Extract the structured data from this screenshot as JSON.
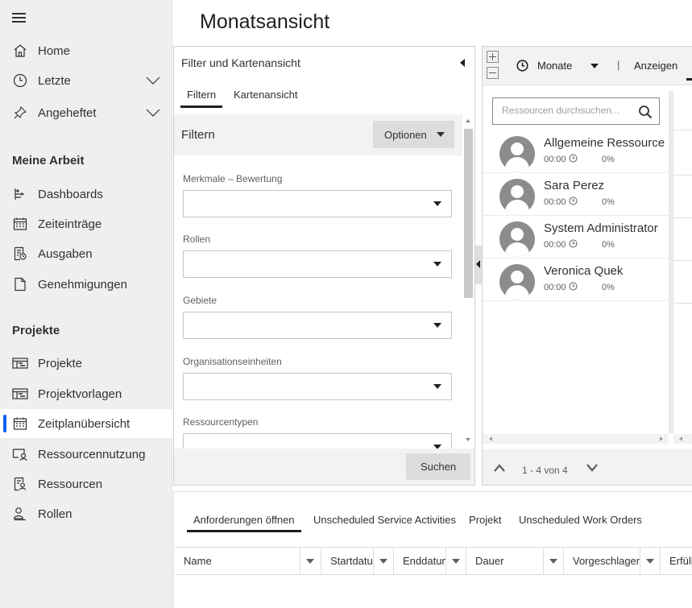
{
  "page_title": "Monatsansicht",
  "sidebar": {
    "items_top": [
      {
        "label": "Home",
        "icon": "home-icon"
      },
      {
        "label": "Letzte",
        "icon": "clock-icon",
        "expandable": true
      },
      {
        "label": "Angeheftet",
        "icon": "pin-icon",
        "expandable": true
      }
    ],
    "section_my_work": "Meine Arbeit",
    "items_my_work": [
      {
        "label": "Dashboards",
        "icon": "dashboard-icon"
      },
      {
        "label": "Zeiteinträge",
        "icon": "calendar-icon"
      },
      {
        "label": "Ausgaben",
        "icon": "receipt-icon"
      },
      {
        "label": "Genehmigungen",
        "icon": "document-icon"
      }
    ],
    "section_projects": "Projekte",
    "items_projects": [
      {
        "label": "Projekte",
        "icon": "project-icon"
      },
      {
        "label": "Projektvorlagen",
        "icon": "project-template-icon"
      },
      {
        "label": "Zeitplanübersicht",
        "icon": "schedule-board-icon",
        "active": true
      },
      {
        "label": "Ressourcennutzung",
        "icon": "resource-utilization-icon"
      },
      {
        "label": "Ressourcen",
        "icon": "resources-icon"
      },
      {
        "label": "Rollen",
        "icon": "roles-icon"
      }
    ]
  },
  "filter_panel": {
    "header": "Filter und Kartenansicht",
    "tabs": [
      "Filtern",
      "Kartenansicht"
    ],
    "active_tab": "Filtern",
    "section_title": "Filtern",
    "options_label": "Optionen",
    "fields": [
      {
        "label": "Merkmale – Bewertung",
        "value": ""
      },
      {
        "label": "Rollen",
        "value": ""
      },
      {
        "label": "Gebiete",
        "value": ""
      },
      {
        "label": "Organisationseinheiten",
        "value": ""
      },
      {
        "label": "Ressourcentypen",
        "value": ""
      }
    ],
    "search_label": "Suchen"
  },
  "resource_panel": {
    "view_label": "Monate",
    "separator": "|",
    "show_label": "Anzeigen",
    "search_placeholder": "Ressourcen durchsuchen...",
    "resources": [
      {
        "name": "Allgemeine Ressource",
        "time": "00:00",
        "percent": "0%"
      },
      {
        "name": "Sara Perez",
        "time": "00:00",
        "percent": "0%"
      },
      {
        "name": "System Administrator",
        "time": "00:00",
        "percent": "0%"
      },
      {
        "name": "Veronica Quek",
        "time": "00:00",
        "percent": "0%"
      }
    ],
    "pager_text": "1 - 4 von 4"
  },
  "bottom": {
    "tabs": [
      "Anforderungen öffnen",
      "Unscheduled Service Activities",
      "Projekt",
      "Unscheduled Work Orders"
    ],
    "active_tab": "Anforderungen öffnen",
    "columns": [
      "Name",
      "Startdatum",
      "Enddatum",
      "Dauer",
      "Vorgeschlagen",
      "Erfüllt"
    ]
  },
  "colors": {
    "accent": "#1160ee",
    "sidebar_bg": "#efefef",
    "button_bg": "#dcdcdc"
  }
}
